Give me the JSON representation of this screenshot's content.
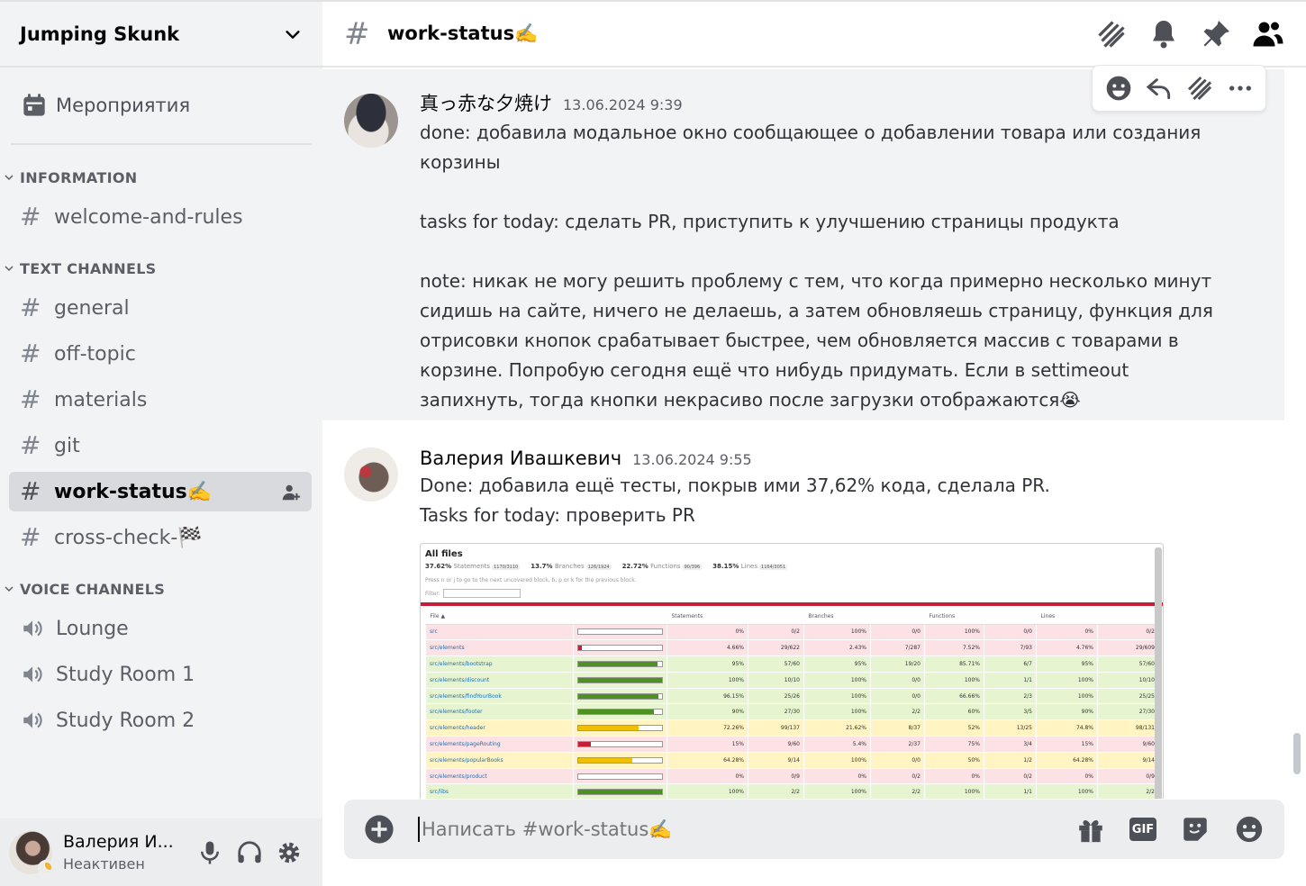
{
  "server": {
    "name": "Jumping Skunk"
  },
  "events": {
    "label": "Мероприятия"
  },
  "categories": {
    "information": "INFORMATION",
    "text": "TEXT CHANNELS",
    "voice": "VOICE CHANNELS"
  },
  "channels": {
    "info": [
      {
        "name": "welcome-and-rules"
      }
    ],
    "text": [
      {
        "name": "general"
      },
      {
        "name": "off-topic"
      },
      {
        "name": "materials"
      },
      {
        "name": "git"
      },
      {
        "name": "work-status✍️",
        "active": true
      },
      {
        "name": "cross-check-🏁"
      }
    ],
    "voice": [
      {
        "name": "Lounge"
      },
      {
        "name": "Study Room 1"
      },
      {
        "name": "Study Room 2"
      }
    ]
  },
  "user": {
    "name": "Валерия И...",
    "status": "Неактивен"
  },
  "header": {
    "channel": "work-status✍️"
  },
  "messages": [
    {
      "author": "真っ赤な夕焼け",
      "time": "13.06.2024 9:39",
      "text": "done: добавила модальное окно сообщающее о добавлении товара или создания корзины\n\ntasks for today: сделать PR, приступить к улучшению страницы продукта\n\nnote: никак не могу решить проблему с тем, что когда примерно несколько минут сидишь на сайте, ничего не делаешь, а затем обновляешь страницу, функция для отрисовки кнопок срабатывает быстрее, чем обновляется массив с товарами в корзине. Попробую сегодня ещё что нибудь придумать. Если в settimeout запихнуть, тогда кнопки некрасиво после загрузки отображаются😭"
    },
    {
      "author": "Валерия Ивашкевич",
      "time": "13.06.2024 9:55",
      "text": "Done: добавила ещё тесты, покрыв ими 37,62% кода, сделала PR.\nTasks for today: проверить PR"
    }
  ],
  "coverage": {
    "title": "All files",
    "summary": [
      {
        "pct": "37.62%",
        "label": "Statements",
        "frac": "1170/3110"
      },
      {
        "pct": "13.7%",
        "label": "Branches",
        "frac": "126/1924"
      },
      {
        "pct": "22.72%",
        "label": "Functions",
        "frac": "90/396"
      },
      {
        "pct": "38.15%",
        "label": "Lines",
        "frac": "1164/3051"
      }
    ],
    "hint": "Press n or j to go to the next uncovered block, b, p or k for the previous block.",
    "filter_label": "Filter:",
    "headers": [
      "File ▲",
      "",
      "Statements",
      "",
      "Branches",
      "",
      "Functions",
      "",
      "Lines",
      ""
    ],
    "rows": [
      {
        "file": "src",
        "pct": 0,
        "cls": "low",
        "cells": [
          "0%",
          "0/2",
          "100%",
          "0/0",
          "100%",
          "0/0",
          "0%",
          "0/2"
        ]
      },
      {
        "file": "src/elements",
        "pct": 4.66,
        "cls": "low",
        "cells": [
          "4.66%",
          "29/622",
          "2.43%",
          "7/287",
          "7.52%",
          "7/93",
          "4.76%",
          "29/609"
        ]
      },
      {
        "file": "src/elements/bootstrap",
        "pct": 95,
        "cls": "high",
        "cells": [
          "95%",
          "57/60",
          "95%",
          "19/20",
          "85.71%",
          "6/7",
          "95%",
          "57/60"
        ]
      },
      {
        "file": "src/elements/discount",
        "pct": 100,
        "cls": "high",
        "cells": [
          "100%",
          "10/10",
          "100%",
          "0/0",
          "100%",
          "1/1",
          "100%",
          "10/10"
        ]
      },
      {
        "file": "src/elements/findYourBook",
        "pct": 96.15,
        "cls": "high",
        "cells": [
          "96.15%",
          "25/26",
          "100%",
          "0/0",
          "66.66%",
          "2/3",
          "100%",
          "25/25"
        ]
      },
      {
        "file": "src/elements/footer",
        "pct": 90,
        "cls": "high",
        "cells": [
          "90%",
          "27/30",
          "100%",
          "2/2",
          "60%",
          "3/5",
          "90%",
          "27/30"
        ]
      },
      {
        "file": "src/elements/header",
        "pct": 72.26,
        "cls": "med",
        "cells": [
          "72.26%",
          "99/137",
          "21.62%",
          "8/37",
          "52%",
          "13/25",
          "74.8%",
          "98/131"
        ]
      },
      {
        "file": "src/elements/pageRouting",
        "pct": 15,
        "cls": "low",
        "cells": [
          "15%",
          "9/60",
          "5.4%",
          "2/37",
          "75%",
          "3/4",
          "15%",
          "9/60"
        ]
      },
      {
        "file": "src/elements/popularBooks",
        "pct": 64.28,
        "cls": "med",
        "cells": [
          "64.28%",
          "9/14",
          "100%",
          "0/0",
          "50%",
          "1/2",
          "64.28%",
          "9/14"
        ]
      },
      {
        "file": "src/elements/product",
        "pct": 0,
        "cls": "low",
        "cells": [
          "0%",
          "0/9",
          "0%",
          "0/2",
          "0%",
          "0/2",
          "0%",
          "0/9"
        ]
      },
      {
        "file": "src/libs",
        "pct": 100,
        "cls": "high",
        "cells": [
          "100%",
          "2/2",
          "100%",
          "2/2",
          "100%",
          "1/1",
          "100%",
          "2/2"
        ]
      }
    ]
  },
  "composer": {
    "placeholder": "Написать #work-status✍️",
    "gif": "GIF"
  },
  "colors": {
    "bar_high": "#4d9221",
    "bar_med": "#f0c000",
    "bar_low": "#c21f39"
  }
}
